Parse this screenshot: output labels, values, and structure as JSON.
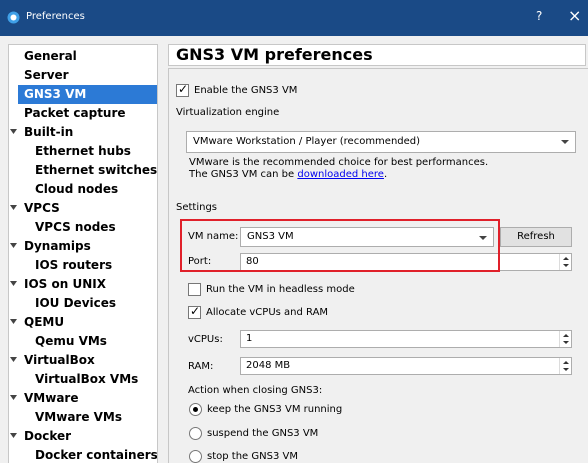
{
  "window": {
    "title": "Preferences",
    "help": "?",
    "close": "×"
  },
  "sidebar": {
    "items": [
      {
        "label": "General"
      },
      {
        "label": "Server"
      },
      {
        "label": "GNS3 VM"
      },
      {
        "label": "Packet capture"
      },
      {
        "label": "Built-in"
      },
      {
        "label": "Ethernet hubs"
      },
      {
        "label": "Ethernet switches"
      },
      {
        "label": "Cloud nodes"
      },
      {
        "label": "VPCS"
      },
      {
        "label": "VPCS nodes"
      },
      {
        "label": "Dynamips"
      },
      {
        "label": "IOS routers"
      },
      {
        "label": "IOS on UNIX"
      },
      {
        "label": "IOU Devices"
      },
      {
        "label": "QEMU"
      },
      {
        "label": "Qemu VMs"
      },
      {
        "label": "VirtualBox"
      },
      {
        "label": "VirtualBox VMs"
      },
      {
        "label": "VMware"
      },
      {
        "label": "VMware VMs"
      },
      {
        "label": "Docker"
      },
      {
        "label": "Docker containers"
      }
    ],
    "selected": "GNS3 VM"
  },
  "panel": {
    "title": "GNS3 VM preferences",
    "enable_label": "Enable the GNS3 VM",
    "engine_label": "Virtualization engine",
    "engine_value": "VMware Workstation / Player (recommended)",
    "engine_note_1": "VMware is the recommended choice for best performances.",
    "engine_note_2_prefix": "The GNS3 VM can be ",
    "engine_note_2_link": "downloaded here",
    "engine_note_2_suffix": ".",
    "settings_label": "Settings",
    "vm_name_label": "VM name:",
    "vm_name_value": "GNS3 VM",
    "refresh_label": "Refresh",
    "port_label": "Port:",
    "port_value": "80",
    "headless_label": "Run the VM in headless mode",
    "allocate_label": "Allocate vCPUs and RAM",
    "vcpus_label": "vCPUs:",
    "vcpus_value": "1",
    "ram_label": "RAM:",
    "ram_value": "2048 MB",
    "closing_label": "Action when closing GNS3:",
    "option_keep": "keep the GNS3 VM running",
    "option_suspend": "suspend the GNS3 VM",
    "option_stop": "stop the GNS3 VM"
  },
  "colors": {
    "titlebar": "#1a4a86",
    "selection": "#2c7ad6",
    "highlight": "#e0202a",
    "link": "#0000ee"
  }
}
